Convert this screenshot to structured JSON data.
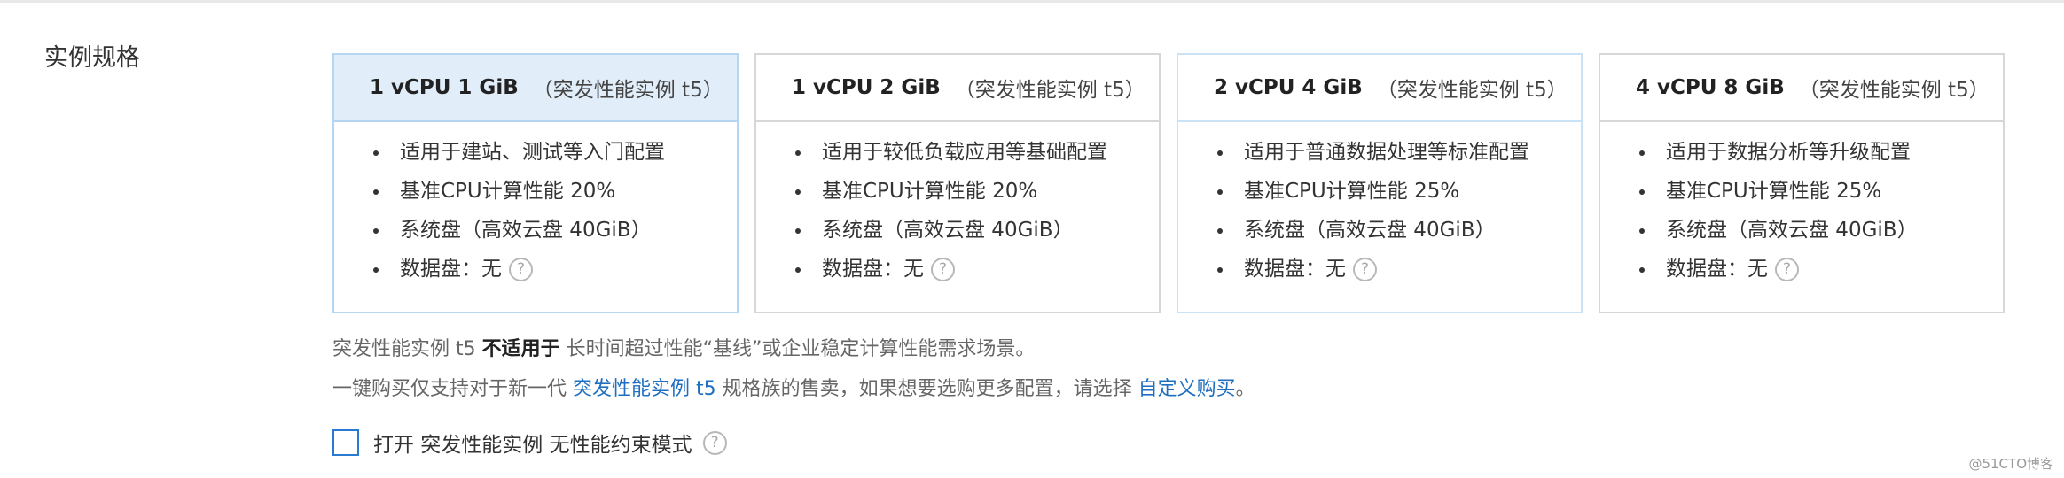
{
  "section": {
    "label": "实例规格"
  },
  "cards": [
    {
      "title": "1 vCPU 1 GiB",
      "subtitle": "（突发性能实例 t5）",
      "items": [
        "适用于建站、测试等入门配置",
        "基准CPU计算性能 20%",
        "系统盘（高效云盘 40GiB）",
        "数据盘：无"
      ]
    },
    {
      "title": "1 vCPU 2 GiB",
      "subtitle": "（突发性能实例 t5）",
      "items": [
        "适用于较低负载应用等基础配置",
        "基准CPU计算性能 20%",
        "系统盘（高效云盘 40GiB）",
        "数据盘：无"
      ]
    },
    {
      "title": "2 vCPU 4 GiB",
      "subtitle": "（突发性能实例 t5）",
      "items": [
        "适用于普通数据处理等标准配置",
        "基准CPU计算性能 25%",
        "系统盘（高效云盘 40GiB）",
        "数据盘：无"
      ]
    },
    {
      "title": "4 vCPU 8 GiB",
      "subtitle": "（突发性能实例 t5）",
      "items": [
        "适用于数据分析等升级配置",
        "基准CPU计算性能 25%",
        "系统盘（高效云盘 40GiB）",
        "数据盘：无"
      ]
    }
  ],
  "help_glyph": "?",
  "notes": {
    "line1_prefix": "突发性能实例 t5 ",
    "line1_bold": "不适用于",
    "line1_suffix": " 长时间超过性能“基线”或企业稳定计算性能需求场景。",
    "line2_prefix": "一键购买仅支持对于新一代 ",
    "line2_link1": "突发性能实例 t5",
    "line2_middle": " 规格族的售卖，如果想要选购更多配置，请选择 ",
    "line2_link2": "自定义购买",
    "line2_suffix": "。"
  },
  "checkbox": {
    "label": "打开 突发性能实例 无性能约束模式",
    "checked": false
  },
  "watermark": "@51CTO博客",
  "colors": {
    "selected_card_header_bg": "#e1eefa",
    "selected_card_border": "#b5d6f2",
    "link": "#1f6fc0",
    "checkbox_border": "#2a7ad2"
  }
}
